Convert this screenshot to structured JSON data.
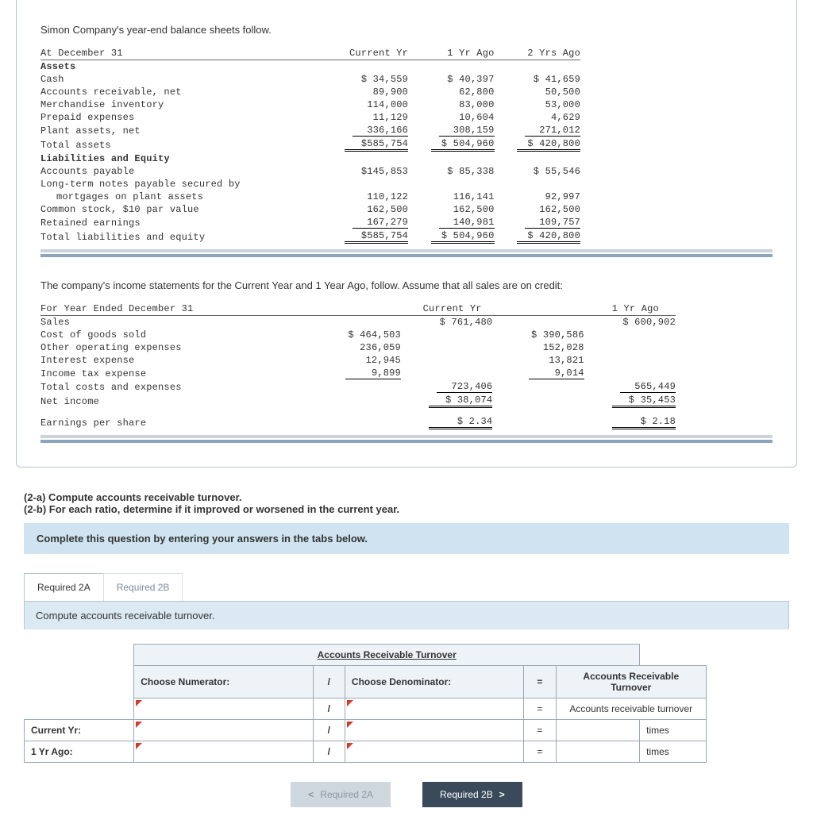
{
  "intro": "Simon Company's year-end balance sheets follow.",
  "bs": {
    "hdr": {
      "c0": "At December 31",
      "c1": "Current Yr",
      "c2": "1 Yr Ago",
      "c3": "2 Yrs Ago"
    },
    "assets_label": "Assets",
    "rows": [
      {
        "l": "Cash",
        "a": "$ 34,559",
        "b": "$  40,397",
        "c": "$  41,659"
      },
      {
        "l": "Accounts receivable, net",
        "a": "89,900",
        "b": "62,800",
        "c": "50,500"
      },
      {
        "l": "Merchandise inventory",
        "a": "114,000",
        "b": "83,000",
        "c": "53,000"
      },
      {
        "l": "Prepaid expenses",
        "a": "11,129",
        "b": "10,604",
        "c": "4,629"
      },
      {
        "l": "Plant assets, net",
        "a": "336,166",
        "b": "308,159",
        "c": "271,012"
      }
    ],
    "total_assets": {
      "l": "Total assets",
      "a": "$585,754",
      "b": "$ 504,960",
      "c": "$ 420,800"
    },
    "le_label": "Liabilities and Equity",
    "ap": {
      "l": "Accounts payable",
      "a": "$145,853",
      "b": "$  85,338",
      "c": "$  55,546"
    },
    "ltnp": "Long-term notes payable secured by",
    "ltnp2": {
      "l": "mortgages on plant assets",
      "a": "110,122",
      "b": "116,141",
      "c": "92,997"
    },
    "cs": {
      "l": "Common stock, $10 par value",
      "a": "162,500",
      "b": "162,500",
      "c": "162,500"
    },
    "re": {
      "l": "Retained earnings",
      "a": "167,279",
      "b": "140,981",
      "c": "109,757"
    },
    "tle": {
      "l": "Total liabilities and equity",
      "a": "$585,754",
      "b": "$ 504,960",
      "c": "$ 420,800"
    }
  },
  "is_intro": "The company's income statements for the Current Year and 1 Year Ago, follow. Assume that all sales are on credit:",
  "is": {
    "hdr": {
      "c0": "For Year Ended December 31",
      "c1": "Current Yr",
      "c2": "1 Yr Ago"
    },
    "sales": {
      "l": "Sales",
      "a": "$ 761,480",
      "b": "$ 600,902"
    },
    "cogs": {
      "l": "Cost of goods sold",
      "a": "$ 464,503",
      "b": "$ 390,586"
    },
    "ooe": {
      "l": "Other operating expenses",
      "a": "236,059",
      "b": "152,028"
    },
    "ie": {
      "l": "Interest expense",
      "a": "12,945",
      "b": "13,821"
    },
    "ite": {
      "l": "Income tax expense",
      "a": "9,899",
      "b": "9,014"
    },
    "tce": {
      "l": "Total costs and expenses",
      "a": "723,406",
      "b": "565,449"
    },
    "ni": {
      "l": "Net income",
      "a": "$  38,074",
      "b": "$  35,453"
    },
    "eps": {
      "l": "Earnings per share",
      "a": "$    2.34",
      "b": "$    2.18"
    }
  },
  "q2a": "(2-a) Compute accounts receivable turnover.",
  "q2b": "(2-b) For each ratio, determine if it improved or worsened in the current year.",
  "blue": "Complete this question by entering your answers in the tabs below.",
  "tabs": {
    "a": "Required 2A",
    "b": "Required 2B"
  },
  "sub": "Compute accounts receivable turnover.",
  "grid": {
    "title": "Accounts Receivable Turnover",
    "num_label": "Choose Numerator:",
    "den_label": "Choose Denominator:",
    "res_label": "Accounts Receivable Turnover",
    "row_result": "Accounts receivable turnover",
    "row_cur": "Current Yr:",
    "row_prev": "1 Yr Ago:",
    "times": "times",
    "slash": "/",
    "eq": "="
  },
  "nav": {
    "prev": "Required 2A",
    "next": "Required 2B"
  }
}
